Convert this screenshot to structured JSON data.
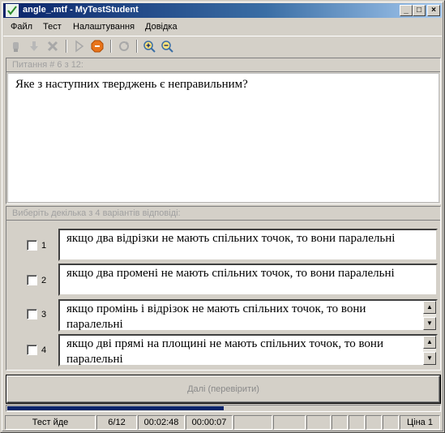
{
  "window": {
    "title": "angle_.mtf - MyTestStudent",
    "min_glyph": "_",
    "max_glyph": "□",
    "close_glyph": "×"
  },
  "menu": [
    "Файл",
    "Тест",
    "Налаштування",
    "Довідка"
  ],
  "toolbar": {
    "icons": [
      "hand-icon",
      "arrow-down-icon",
      "cross-icon",
      "play-icon",
      "stop-icon",
      "refresh-icon",
      "zoom-in-icon",
      "zoom-out-icon"
    ]
  },
  "question": {
    "header": "Питання # 6 з 12:",
    "text": "Яке з наступних тверджень є неправильним?"
  },
  "answers": {
    "header": "Виберіть декілька з 4 варіантів відповіді:",
    "items": [
      {
        "num": "1",
        "text": "якщо два відрізки не мають спільних точок, то вони паралельні",
        "checked": false
      },
      {
        "num": "2",
        "text": "якщо два промені не мають спільних точок, то вони паралельні",
        "checked": false
      },
      {
        "num": "3",
        "text": "якщо промінь і  відрізок не мають спільних точок, то вони паралельні",
        "checked": false
      },
      {
        "num": "4",
        "text": "якщо дві прямі на площині не мають спільних точок, то вони паралельні",
        "checked": false
      }
    ]
  },
  "next_button": "Далі (перевірити)",
  "progress": 0.5,
  "status": {
    "state": "Тест йде",
    "counter": "6/12",
    "elapsed": "00:02:48",
    "question_time": "00:00:07",
    "price": "Ціна 1"
  },
  "colors": {
    "title_start": "#0a246a",
    "title_end": "#a6caf0",
    "progress": "#0a246a",
    "face": "#d4d0c8"
  }
}
